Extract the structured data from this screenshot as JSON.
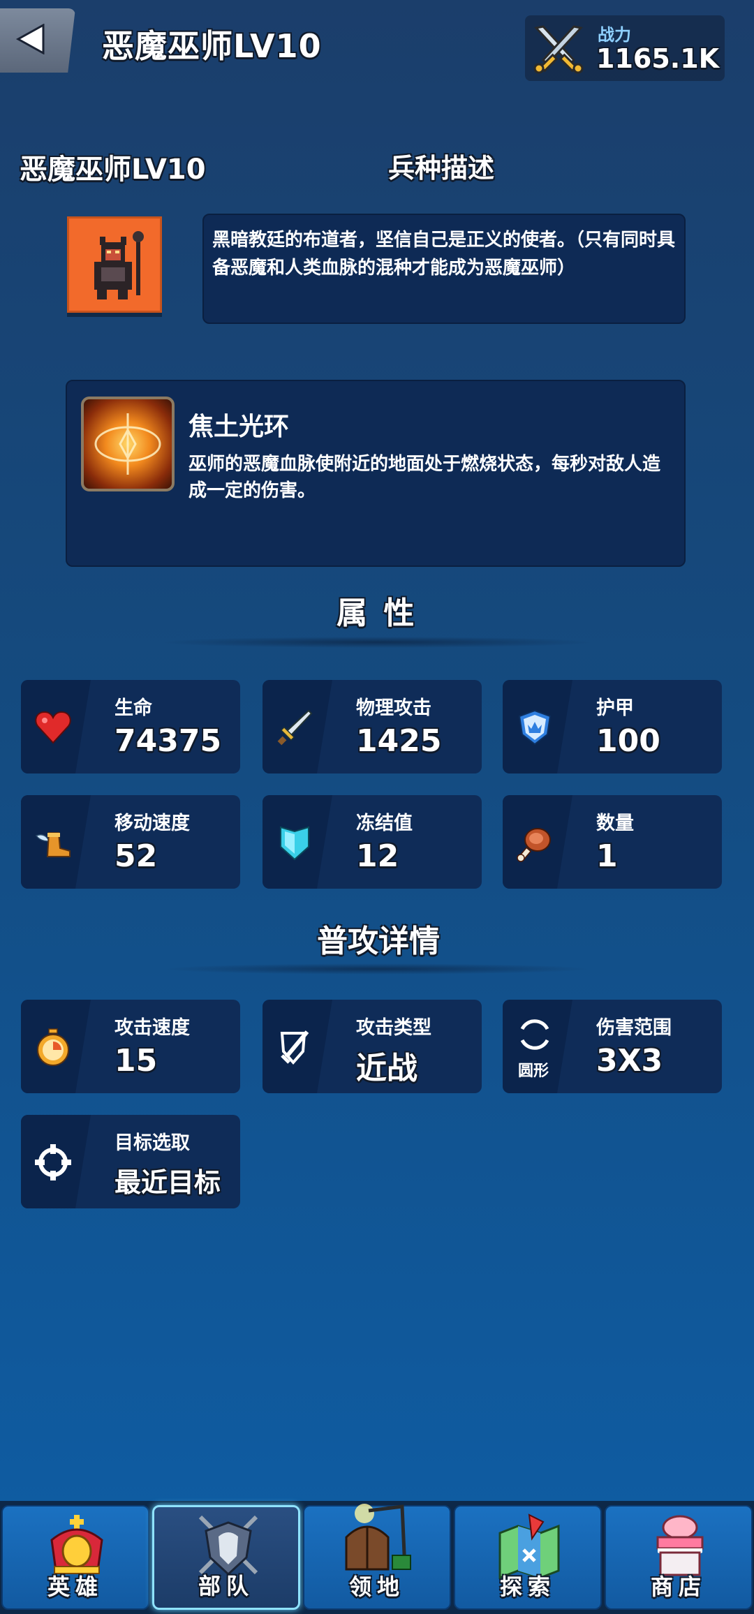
{
  "header": {
    "title": "恶魔巫师LV10",
    "power_label": "战力",
    "power_value": "1165.1K"
  },
  "unit": {
    "name": "恶魔巫师LV10",
    "desc_title": "兵种描述",
    "description": "黑暗教廷的布道者，坚信自己是正义的使者。（只有同时具备恶魔和人类血脉的混种才能成为恶魔巫师）"
  },
  "skill": {
    "name": "焦土光环",
    "description": "巫师的恶魔血脉使附近的地面处于燃烧状态，每秒对敌人造成一定的伤害。"
  },
  "attributes": {
    "title": "属  性",
    "items": [
      {
        "label": "生命",
        "value": "74375",
        "icon": "heart-icon"
      },
      {
        "label": "物理攻击",
        "value": "1425",
        "icon": "sword-icon"
      },
      {
        "label": "护甲",
        "value": "100",
        "icon": "shield-crown-icon"
      },
      {
        "label": "移动速度",
        "value": "52",
        "icon": "winged-boot-icon"
      },
      {
        "label": "冻结值",
        "value": "12",
        "icon": "ice-shield-icon"
      },
      {
        "label": "数量",
        "value": "1",
        "icon": "meat-icon"
      }
    ]
  },
  "attack": {
    "title": "普攻详情",
    "items": [
      {
        "label": "攻击速度",
        "value": "15",
        "icon": "stopwatch-icon"
      },
      {
        "label": "攻击类型",
        "value": "近战",
        "icon": "melee-icon"
      },
      {
        "label": "伤害范围",
        "value": "3X3",
        "icon": "range-icon",
        "icon_caption": "圆形"
      },
      {
        "label": "目标选取",
        "value": "最近目标",
        "icon": "target-icon"
      }
    ]
  },
  "nav": {
    "items": [
      {
        "label": "英雄",
        "icon": "crown-icon"
      },
      {
        "label": "部队",
        "icon": "crest-icon",
        "active": true
      },
      {
        "label": "领地",
        "icon": "house-icon"
      },
      {
        "label": "探索",
        "icon": "map-icon"
      },
      {
        "label": "商店",
        "icon": "shop-icon"
      }
    ]
  },
  "colors": {
    "accent": "#8fe3ff",
    "portrait_bg": "#f26a2b",
    "power_label": "#8fd1ff"
  }
}
